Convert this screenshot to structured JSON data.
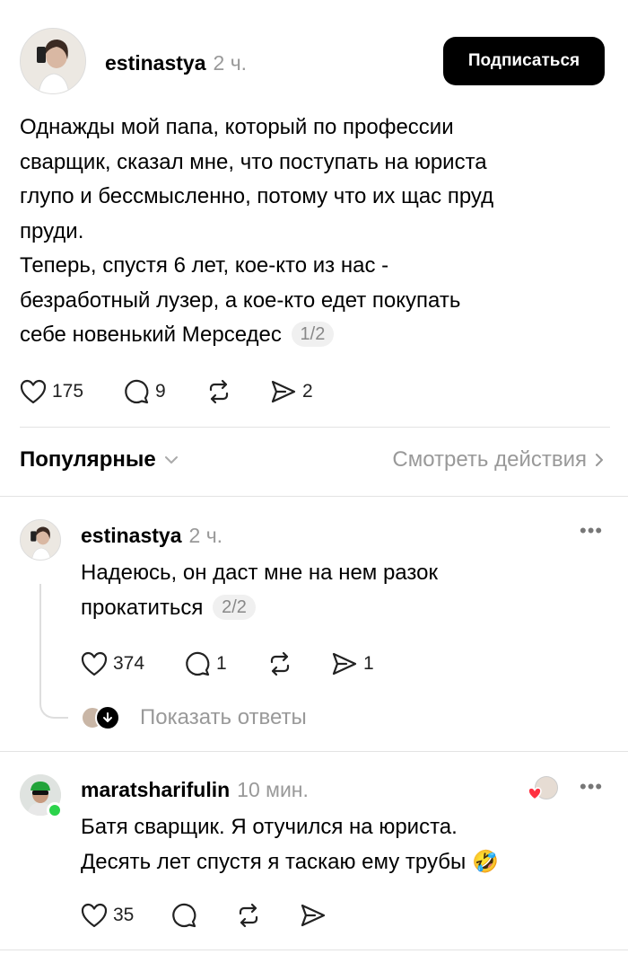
{
  "post": {
    "username": "estinastya",
    "time": "2 ч.",
    "follow_label": "Подписаться",
    "text_lines": [
      "Однажды мой папа, который по профессии",
      "сварщик, сказал мне, что поступать на юриста",
      "глупо и бессмысленно, потому что их щас пруд",
      "пруди.",
      "Теперь, спустя 6 лет, кое-кто из нас -",
      "безработный лузер, а кое-кто едет покупать",
      "себе новенький Мерседес"
    ],
    "counter": "1/2",
    "likes": "175",
    "replies": "9",
    "shares": "2"
  },
  "sort": {
    "label": "Популярные",
    "activity_label": "Смотреть действия"
  },
  "reply1": {
    "username": "estinastya",
    "time": "2 ч.",
    "text_lines": [
      "Надеюсь, он даст мне на нем разок",
      "прокатиться"
    ],
    "counter": "2/2",
    "likes": "374",
    "replies": "1",
    "shares": "1",
    "show_replies": "Показать ответы"
  },
  "reply2": {
    "username": "maratsharifulin",
    "time": "10 мин.",
    "text_lines": [
      "Батя сварщик. Я отучился на юриста.",
      "Десять лет спустя я таскаю ему трубы"
    ],
    "emoji": "🤣",
    "likes": "35"
  },
  "icons": {
    "like": "heart-icon",
    "reply": "comment-icon",
    "repost": "repost-icon",
    "share": "send-icon",
    "more": "more-icon"
  },
  "colors": {
    "accent": "#000000",
    "muted": "#999999",
    "online": "#2bd34b",
    "liked": "#ff3040"
  }
}
